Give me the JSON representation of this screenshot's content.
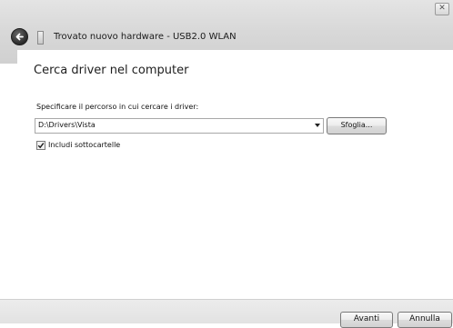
{
  "window": {
    "title": "Trovato nuovo hardware - USB2.0 WLAN",
    "close_glyph": "✕"
  },
  "page": {
    "heading": "Cerca driver nel computer",
    "path_label": "Specificare il percorso in cui cercare i driver:",
    "path_value": "D:\\Drivers\\Vista",
    "browse_label": "Sfoglia...",
    "include_subfolders_label": "Includi sottocartelle",
    "include_subfolders_checked": true
  },
  "footer": {
    "next_label": "Avanti",
    "cancel_label": "Annulla"
  },
  "icons": {
    "back": "back-arrow-icon",
    "hardware": "hardware-device-icon",
    "close": "close-icon",
    "dropdown": "chevron-down-icon",
    "check": "checkmark-icon"
  }
}
